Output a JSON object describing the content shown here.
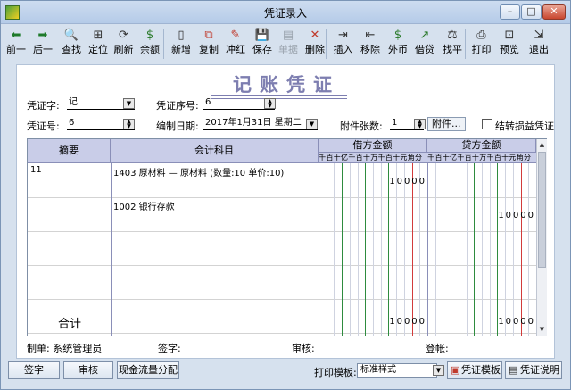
{
  "window": {
    "title": "凭证录入",
    "minimize": "–",
    "maximize": "□",
    "close": "✕"
  },
  "toolbar": [
    {
      "name": "prev",
      "label": "前一",
      "icon": "⬅",
      "color": "#1d7a2a",
      "disabled": false
    },
    {
      "name": "next",
      "label": "后一",
      "icon": "➡",
      "color": "#1d7a2a",
      "disabled": false
    },
    {
      "name": "find",
      "label": "查找",
      "icon": "🔍",
      "color": "#333",
      "disabled": false
    },
    {
      "name": "locate",
      "label": "定位",
      "icon": "⊞",
      "color": "#333",
      "disabled": false
    },
    {
      "name": "refresh",
      "label": "刷新",
      "icon": "⟳",
      "color": "#333",
      "disabled": false
    },
    {
      "name": "balance",
      "label": "余额",
      "icon": "$",
      "color": "#2a7a2a",
      "disabled": false
    },
    {
      "name": "new",
      "label": "新增",
      "icon": "▯",
      "color": "#333",
      "disabled": false
    },
    {
      "name": "copy",
      "label": "复制",
      "icon": "⧉",
      "color": "#c0392b",
      "disabled": false
    },
    {
      "name": "reverse",
      "label": "冲红",
      "icon": "✎",
      "color": "#c0392b",
      "disabled": false
    },
    {
      "name": "save",
      "label": "保存",
      "icon": "💾",
      "color": "#333",
      "disabled": false
    },
    {
      "name": "document",
      "label": "单据",
      "icon": "▤",
      "color": "#9aa3ad",
      "disabled": true
    },
    {
      "name": "delete",
      "label": "删除",
      "icon": "✕",
      "color": "#c0392b",
      "disabled": false
    },
    {
      "name": "insert",
      "label": "插入",
      "icon": "⇥",
      "color": "#333",
      "disabled": false
    },
    {
      "name": "remove",
      "label": "移除",
      "icon": "⇤",
      "color": "#333",
      "disabled": false
    },
    {
      "name": "foreign-currency",
      "label": "外币",
      "icon": "$",
      "color": "#2a7a2a",
      "disabled": false
    },
    {
      "name": "borrow-credit",
      "label": "借贷",
      "icon": "↗",
      "color": "#2a7a2a",
      "disabled": false
    },
    {
      "name": "balance-even",
      "label": "找平",
      "icon": "⚖",
      "color": "#333",
      "disabled": false
    },
    {
      "name": "print",
      "label": "打印",
      "icon": "⎙",
      "color": "#333",
      "disabled": false
    },
    {
      "name": "preview",
      "label": "预览",
      "icon": "⊡",
      "color": "#333",
      "disabled": false
    },
    {
      "name": "exit",
      "label": "退出",
      "icon": "⇲",
      "color": "#333",
      "disabled": false
    }
  ],
  "voucher": {
    "title": "记账凭证",
    "word_label": "凭证字:",
    "word_value": "记",
    "seq_label": "凭证序号:",
    "seq_value": "6",
    "number_label": "凭证号:",
    "number_value": "6",
    "date_label": "编制日期:",
    "date_value": "2017年1月31日 星期二",
    "attach_label": "附件张数:",
    "attach_value": "1",
    "attach_button": "附件...",
    "carry_label": "结转损益凭证"
  },
  "grid": {
    "headers": {
      "summary": "摘要",
      "account": "会计科目",
      "debit": "借方金额",
      "credit": "贷方金额",
      "digits": [
        "千",
        "百",
        "十",
        "亿",
        "千",
        "百",
        "十",
        "万",
        "千",
        "百",
        "十",
        "元",
        "角",
        "分"
      ]
    },
    "rows": [
      {
        "summary": "11",
        "account": "1403  原材料 — 原材料 (数量:10 单价:10)",
        "debit": "10000",
        "credit": ""
      },
      {
        "summary": "",
        "account": "1002  银行存款",
        "debit": "",
        "credit": "10000"
      },
      {
        "summary": "",
        "account": "",
        "debit": "",
        "credit": ""
      },
      {
        "summary": "",
        "account": "",
        "debit": "",
        "credit": ""
      }
    ],
    "total_label": "合计",
    "total_debit": "10000",
    "total_credit": "10000"
  },
  "footer_info": {
    "maker": "制单: 系统管理员",
    "sign": "签字:",
    "audit": "审核:",
    "post": "登帐:"
  },
  "buttons": {
    "sign": "签字",
    "audit": "审核",
    "cashflow": "现金流量分配",
    "print_template_label": "打印模板:",
    "print_template_value": "标准样式",
    "template_button": "凭证模板",
    "help_button": "凭证说明"
  }
}
